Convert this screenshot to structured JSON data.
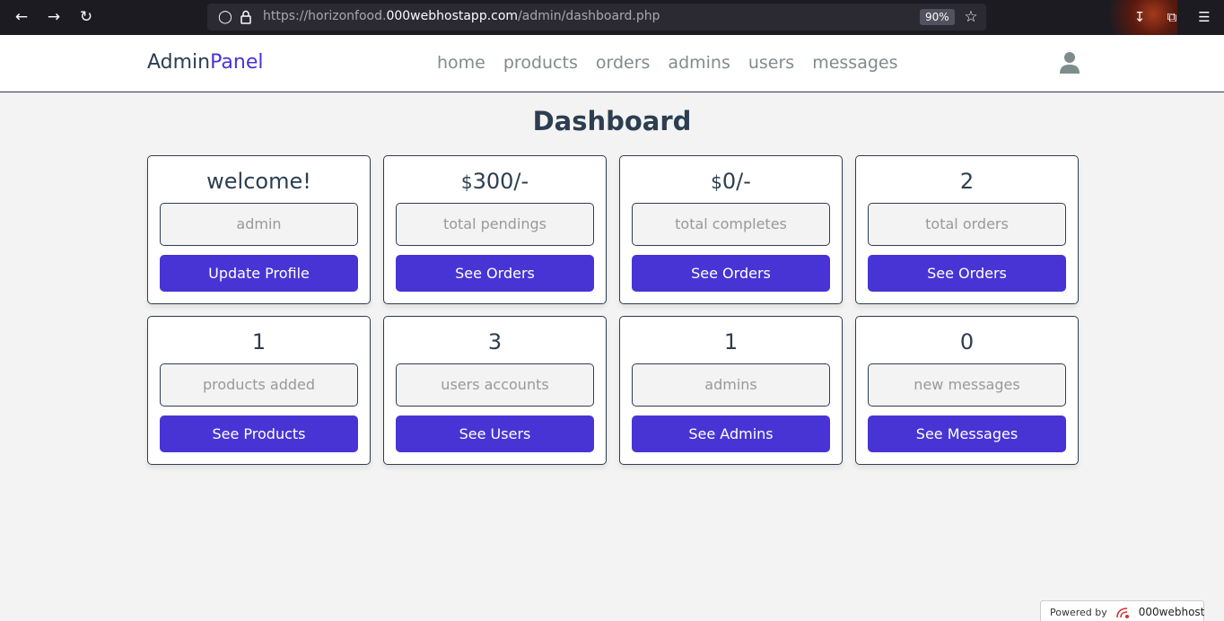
{
  "browser": {
    "url_prefix": "https://horizonfood.",
    "url_host": "000webhostapp.com",
    "url_path": "/admin/dashboard.php",
    "zoom": "90%"
  },
  "header": {
    "logo_main": "Admin",
    "logo_accent": "Panel",
    "nav": [
      "home",
      "products",
      "orders",
      "admins",
      "users",
      "messages"
    ]
  },
  "page": {
    "title": "Dashboard"
  },
  "cards": [
    {
      "value": "welcome!",
      "label": "admin",
      "button": "Update Profile"
    },
    {
      "currency": "$",
      "value": "300/-",
      "label": "total pendings",
      "button": "See Orders"
    },
    {
      "currency": "$",
      "value": "0/-",
      "label": "total completes",
      "button": "See Orders"
    },
    {
      "value": "2",
      "label": "total orders",
      "button": "See Orders"
    },
    {
      "value": "1",
      "label": "products added",
      "button": "See Products"
    },
    {
      "value": "3",
      "label": "users accounts",
      "button": "See Users"
    },
    {
      "value": "1",
      "label": "admins",
      "button": "See Admins"
    },
    {
      "value": "0",
      "label": "new messages",
      "button": "See Messages"
    }
  ],
  "footer": {
    "powered_by": "Powered by",
    "brand": "000webhost"
  },
  "colors": {
    "accent": "#4834d4",
    "text": "#2c3e50",
    "background": "#f3f3f3"
  }
}
